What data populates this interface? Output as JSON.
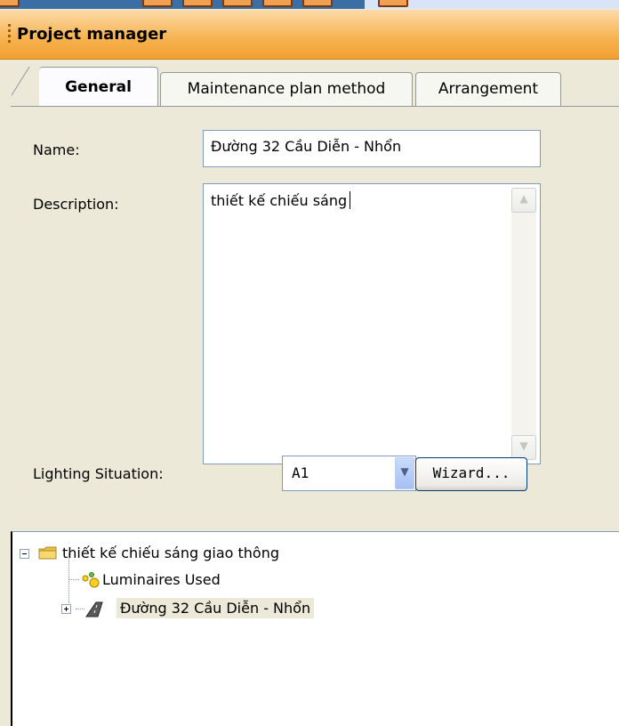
{
  "window": {
    "panel_title": "Project manager"
  },
  "tabs": [
    {
      "label": "General",
      "active": true
    },
    {
      "label": "Maintenance plan method",
      "active": false
    },
    {
      "label": "Arrangement",
      "active": false
    }
  ],
  "general": {
    "name_label": "Name:",
    "name_value": "Đường 32 Cầu Diễn - Nhổn",
    "description_label": "Description:",
    "description_value": "thiết kế chiếu sáng",
    "lighting_label": "Lighting Situation:",
    "lighting_value": "A1",
    "wizard_label": "Wizard..."
  },
  "tree": {
    "root": {
      "label": "thiết kế chiếu sáng giao thông",
      "icon": "folder-icon",
      "expanded": true
    },
    "children": [
      {
        "label": "Luminaires Used",
        "icon": "luminaires-icon"
      },
      {
        "label": "Đường 32 Cầu Diễn - Nhổn",
        "icon": "road-icon",
        "selected": true
      }
    ]
  },
  "colors": {
    "header_gradient_top": "#fcdba8",
    "header_gradient_bottom": "#f2a030",
    "panel_bg": "#ece9d8",
    "field_border": "#7f9db9"
  }
}
